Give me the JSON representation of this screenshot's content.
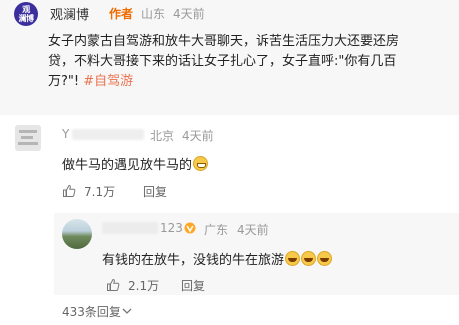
{
  "post": {
    "author_logo_text": [
      "观",
      "澜博"
    ],
    "author": "观澜博",
    "author_badge": "作者",
    "location": "山东",
    "time": "4天前",
    "body_line1": "女子内蒙古自驾游和放牛大哥聊天，诉苦生活压力大还要还房",
    "body_line2": "贷，不料大哥接下来的话让女子扎心了，女子直呼:\"你有几百",
    "body_line3_text": "万?\"! ",
    "hashtag": "#自驾游"
  },
  "comment": {
    "username_visible": "Y",
    "location": "北京",
    "time": "4天前",
    "text": "做牛马的遇见放牛马的",
    "likes": "7.1万",
    "reply_label": "回复"
  },
  "reply": {
    "username_visible_suffix": "123",
    "location": "广东",
    "time": "4天前",
    "text": "有钱的在放牛，没钱的牛在旅游",
    "likes": "2.1万",
    "reply_label": "回复"
  },
  "more_replies": "433条回复",
  "colors": {
    "accent_orange": "#f06c00",
    "hashtag": "#eb7350",
    "verify_badge": "#ffa726",
    "logo_bg": "#3a2f9c"
  },
  "icons": [
    "like-icon",
    "verify-icon",
    "chevron-down-icon"
  ]
}
